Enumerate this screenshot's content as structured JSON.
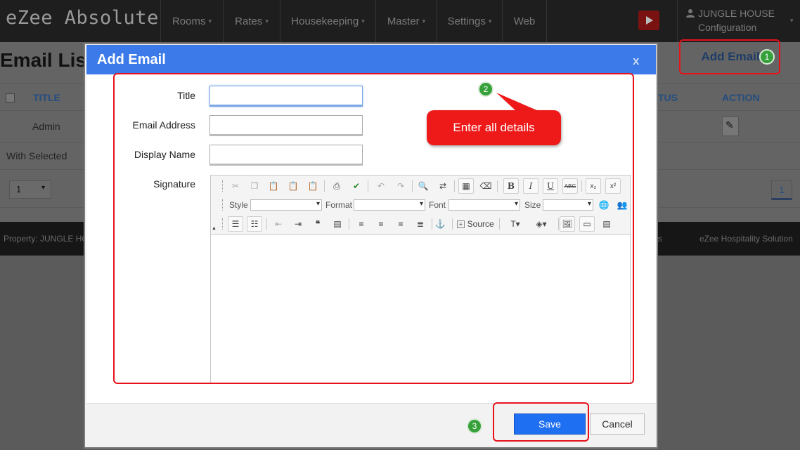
{
  "app": {
    "brand": "eZee Absolute"
  },
  "nav": {
    "items": [
      {
        "label": "Rooms",
        "dropdown": true
      },
      {
        "label": "Rates",
        "dropdown": true
      },
      {
        "label": "Housekeeping",
        "dropdown": true
      },
      {
        "label": "Master",
        "dropdown": true
      },
      {
        "label": "Settings",
        "dropdown": true
      },
      {
        "label": "Web",
        "dropdown": false
      }
    ],
    "user_name": "JUNGLE HOUSE",
    "user_sub": "Configuration"
  },
  "page": {
    "title": "Email Lis",
    "add_button": "Add Email",
    "columns": {
      "title": "TITLE",
      "status": "TUS",
      "action": "ACTION"
    },
    "rows": [
      {
        "title": "Admin"
      }
    ],
    "with_selected": "With Selected",
    "page_size": "1",
    "current_page": "1",
    "footer_left": "Property: JUNGLE HO",
    "footer_mid": "ls",
    "footer_right": "eZee Hospitality Solution"
  },
  "modal": {
    "title": "Add Email",
    "close": "x",
    "fields": {
      "title_label": "Title",
      "email_label": "Email Address",
      "display_label": "Display Name",
      "signature_label": "Signature"
    },
    "editor": {
      "style_label": "Style",
      "format_label": "Format",
      "font_label": "Font",
      "size_label": "Size",
      "source_label": "Source",
      "tools_row1": [
        "scissors-icon",
        "copy-icon",
        "paste-icon",
        "paste-text-icon",
        "paste-word-icon",
        "print-icon",
        "spellcheck-icon",
        "undo-icon",
        "redo-icon",
        "find-icon",
        "replace-icon",
        "select-all-icon",
        "remove-format-icon",
        "bold-icon",
        "italic-icon",
        "underline-icon",
        "strike-icon",
        "subscript-icon",
        "superscript-icon"
      ]
    },
    "save_label": "Save",
    "cancel_label": "Cancel"
  },
  "annotations": {
    "step1": "1",
    "step2": "2",
    "step3": "3",
    "callout": "Enter all details",
    "accent_red": "#e8121b",
    "badge_green": "#36a03a"
  }
}
